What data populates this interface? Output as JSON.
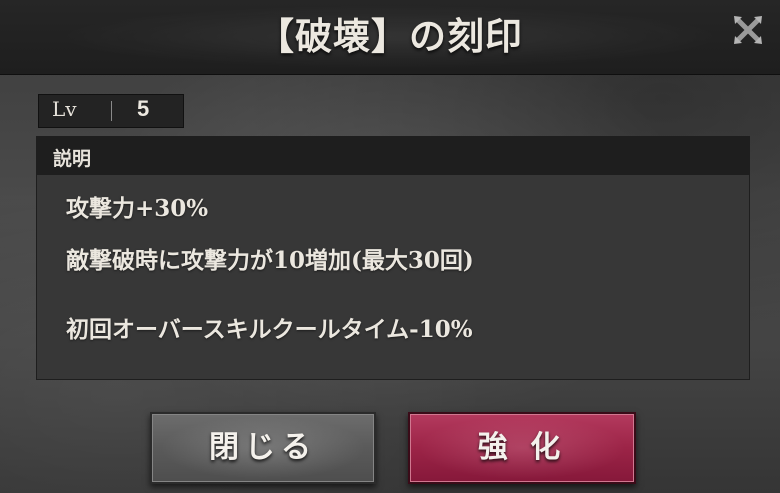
{
  "dialog": {
    "title": "【破壊】の刻印",
    "close_icon": "close-icon"
  },
  "level": {
    "label": "Lv",
    "value": "5"
  },
  "description": {
    "header": "説明",
    "lines": [
      "攻撃力+30%",
      "敵撃破時に攻撃力が10増加(最大30回)",
      "初回オーバースキルクールタイム-10%"
    ]
  },
  "buttons": {
    "close_label": "閉じる",
    "enhance_label": "強 化"
  },
  "colors": {
    "enhance_button": "#9c2447",
    "close_button": "#5a5a5a",
    "title_bar": "#1e1e1e"
  }
}
